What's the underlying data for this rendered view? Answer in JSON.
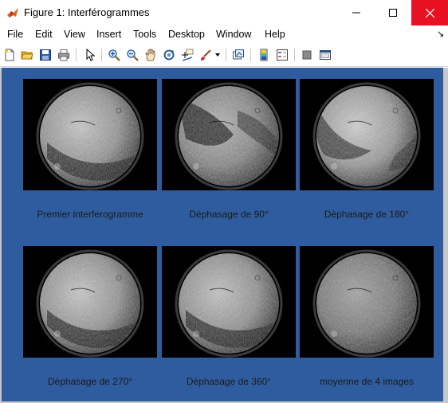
{
  "window": {
    "title": "Figure 1: Interférogrammes"
  },
  "menu": [
    "File",
    "Edit",
    "View",
    "Insert",
    "Tools",
    "Desktop",
    "Window",
    "Help"
  ],
  "toolbar_icons": [
    "new-figure-icon",
    "open-file-icon",
    "save-icon",
    "print-icon",
    "pointer-icon",
    "zoom-in-icon",
    "zoom-out-icon",
    "pan-icon",
    "rotate-3d-icon",
    "data-cursor-icon",
    "brush-icon",
    "link-plot-icon",
    "colorbar-icon",
    "legend-icon",
    "hide-plot-tools-icon",
    "show-plot-tools-icon"
  ],
  "colors": {
    "figure_bg": "#2f5c9e",
    "close_button": "#e81123",
    "caption_text": "#1a1a1a"
  },
  "panels": [
    {
      "caption": "Premier interferogramme",
      "brightness": 0.8,
      "band": "dark-lower-band"
    },
    {
      "caption": "Dèphasage de 90°",
      "brightness": 0.7,
      "band": "dark-center-band"
    },
    {
      "caption": "Dèphasage de 180°",
      "brightness": 0.85,
      "band": "dark-upper-left"
    },
    {
      "caption": "Dèphasage de 270°",
      "brightness": 0.8,
      "band": "dark-lower-band"
    },
    {
      "caption": "Dèphasage de 360°",
      "brightness": 0.78,
      "band": "dark-lower-band"
    },
    {
      "caption": "moyenne de 4 images",
      "brightness": 0.6,
      "band": "uniform"
    }
  ]
}
